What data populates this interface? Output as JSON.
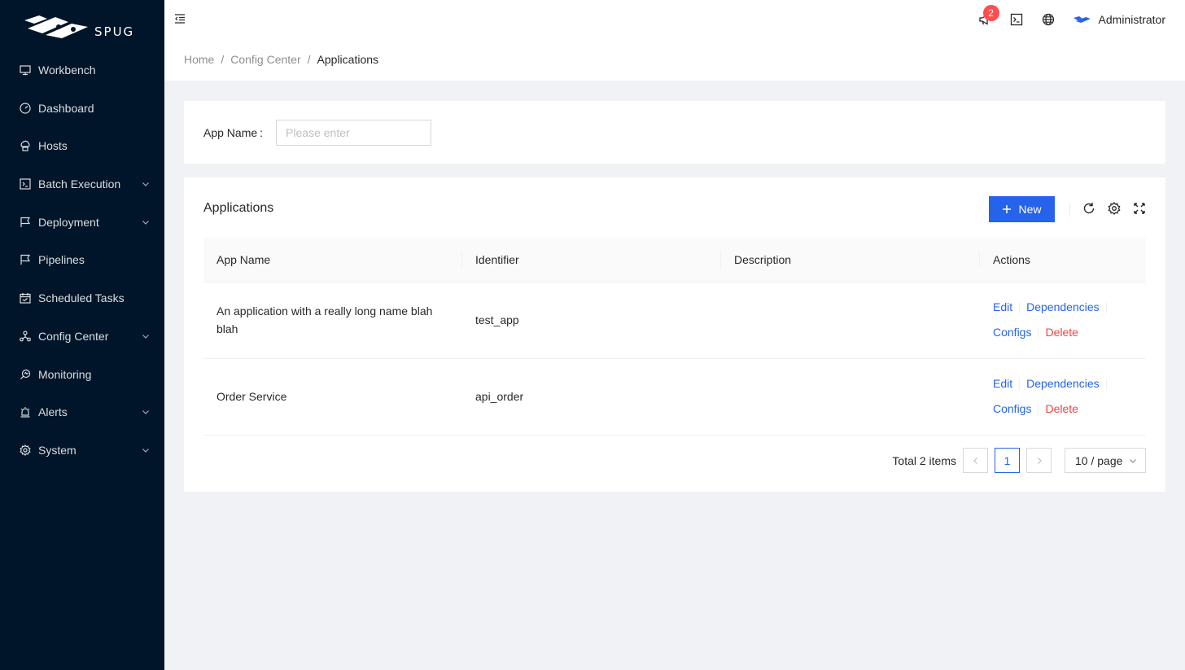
{
  "app": {
    "logo_text": "SPUG"
  },
  "sidebar": {
    "items": [
      {
        "label": "Workbench",
        "icon": "desktop-icon",
        "has_arrow": false
      },
      {
        "label": "Dashboard",
        "icon": "dashboard-icon",
        "has_arrow": false
      },
      {
        "label": "Hosts",
        "icon": "cloud-server-icon",
        "has_arrow": false
      },
      {
        "label": "Batch Execution",
        "icon": "code-icon",
        "has_arrow": true
      },
      {
        "label": "Deployment",
        "icon": "flag-icon",
        "has_arrow": true
      },
      {
        "label": "Pipelines",
        "icon": "flag-icon",
        "has_arrow": false
      },
      {
        "label": "Scheduled Tasks",
        "icon": "schedule-icon",
        "has_arrow": false
      },
      {
        "label": "Config Center",
        "icon": "deployment-unit-icon",
        "has_arrow": true
      },
      {
        "label": "Monitoring",
        "icon": "monitor-icon",
        "has_arrow": false
      },
      {
        "label": "Alerts",
        "icon": "alert-icon",
        "has_arrow": true
      },
      {
        "label": "System",
        "icon": "setting-icon",
        "has_arrow": true
      }
    ]
  },
  "header": {
    "notification_count": "2",
    "user_name": "Administrator"
  },
  "breadcrumb": {
    "home": "Home",
    "sep": "/",
    "config_center": "Config Center",
    "current": "Applications"
  },
  "search": {
    "label": "App Name",
    "colon": ":",
    "placeholder": "Please enter"
  },
  "table_card": {
    "title": "Applications",
    "new_button": "New"
  },
  "table": {
    "columns": [
      "App Name",
      "Identifier",
      "Description",
      "Actions"
    ],
    "rows": [
      {
        "name": "An application with a really long name blah blah",
        "identifier": "test_app",
        "description": ""
      },
      {
        "name": "Order Service",
        "identifier": "api_order",
        "description": ""
      }
    ],
    "actions": {
      "edit": "Edit",
      "dependencies": "Dependencies",
      "configs": "Configs",
      "delete": "Delete"
    }
  },
  "pagination": {
    "total": "Total 2 items",
    "current_page": "1",
    "page_size": "10 / page"
  },
  "colors": {
    "primary": "#2563eb",
    "danger": "#ef4444",
    "sidebar_bg": "#001529"
  }
}
